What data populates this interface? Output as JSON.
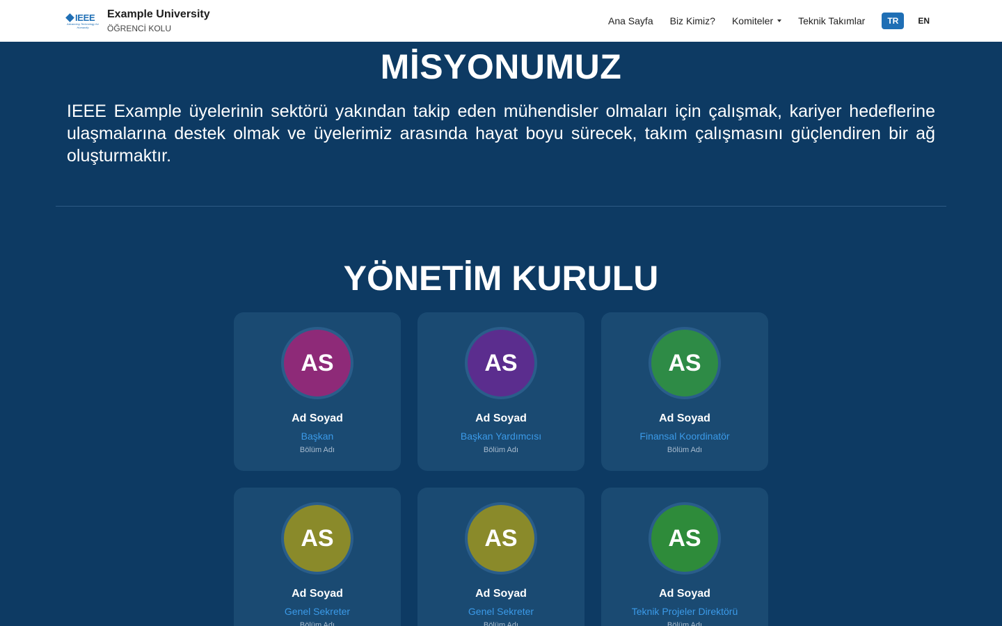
{
  "navbar": {
    "logo_text": "IEEE",
    "logo_tagline": "Advancing Technology for Humanity",
    "brand_title": "Example University",
    "brand_subtitle": "ÖĞRENCİ KOLU",
    "links": [
      {
        "label": "Ana Sayfa"
      },
      {
        "label": "Biz Kimiz?"
      },
      {
        "label": "Komiteler"
      },
      {
        "label": "Teknik Takımlar"
      }
    ],
    "lang_tr": "TR",
    "lang_en": "EN",
    "active_lang": "TR"
  },
  "mission": {
    "title": "MİSYONUMUZ",
    "text": "IEEE Example üyelerinin sektörü yakından takip eden mühendisler olmaları için çalışmak, kariyer hedeflerine ulaşmalarına destek olmak ve üyelerimiz arasında hayat boyu sürecek, takım çalışmasını güçlendiren bir ağ oluşturmaktır."
  },
  "board": {
    "title": "YÖNETİM KURULU",
    "members": [
      {
        "initials": "AS",
        "name": "Ad Soyad",
        "role": "Başkan",
        "dept": "Bölüm Adı",
        "color": "#8e2a78"
      },
      {
        "initials": "AS",
        "name": "Ad Soyad",
        "role": "Başkan Yardımcısı",
        "dept": "Bölüm Adı",
        "color": "#5b2d8e"
      },
      {
        "initials": "AS",
        "name": "Ad Soyad",
        "role": "Finansal Koordinatör",
        "dept": "Bölüm Adı",
        "color": "#2e8b46"
      },
      {
        "initials": "AS",
        "name": "Ad Soyad",
        "role": "Genel Sekreter",
        "dept": "Bölüm Adı",
        "color": "#8a8a2a"
      },
      {
        "initials": "AS",
        "name": "Ad Soyad",
        "role": "Genel Sekreter",
        "dept": "Bölüm Adı",
        "color": "#8a8a2a"
      },
      {
        "initials": "AS",
        "name": "Ad Soyad",
        "role": "Teknik Projeler Direktörü",
        "dept": "Bölüm Adı",
        "color": "#2e8b3a"
      }
    ]
  },
  "colors": {
    "background": "#0d3a63",
    "card": "#1a4a72",
    "accent": "#1f6fb5",
    "role_text": "#3b9ae8"
  }
}
